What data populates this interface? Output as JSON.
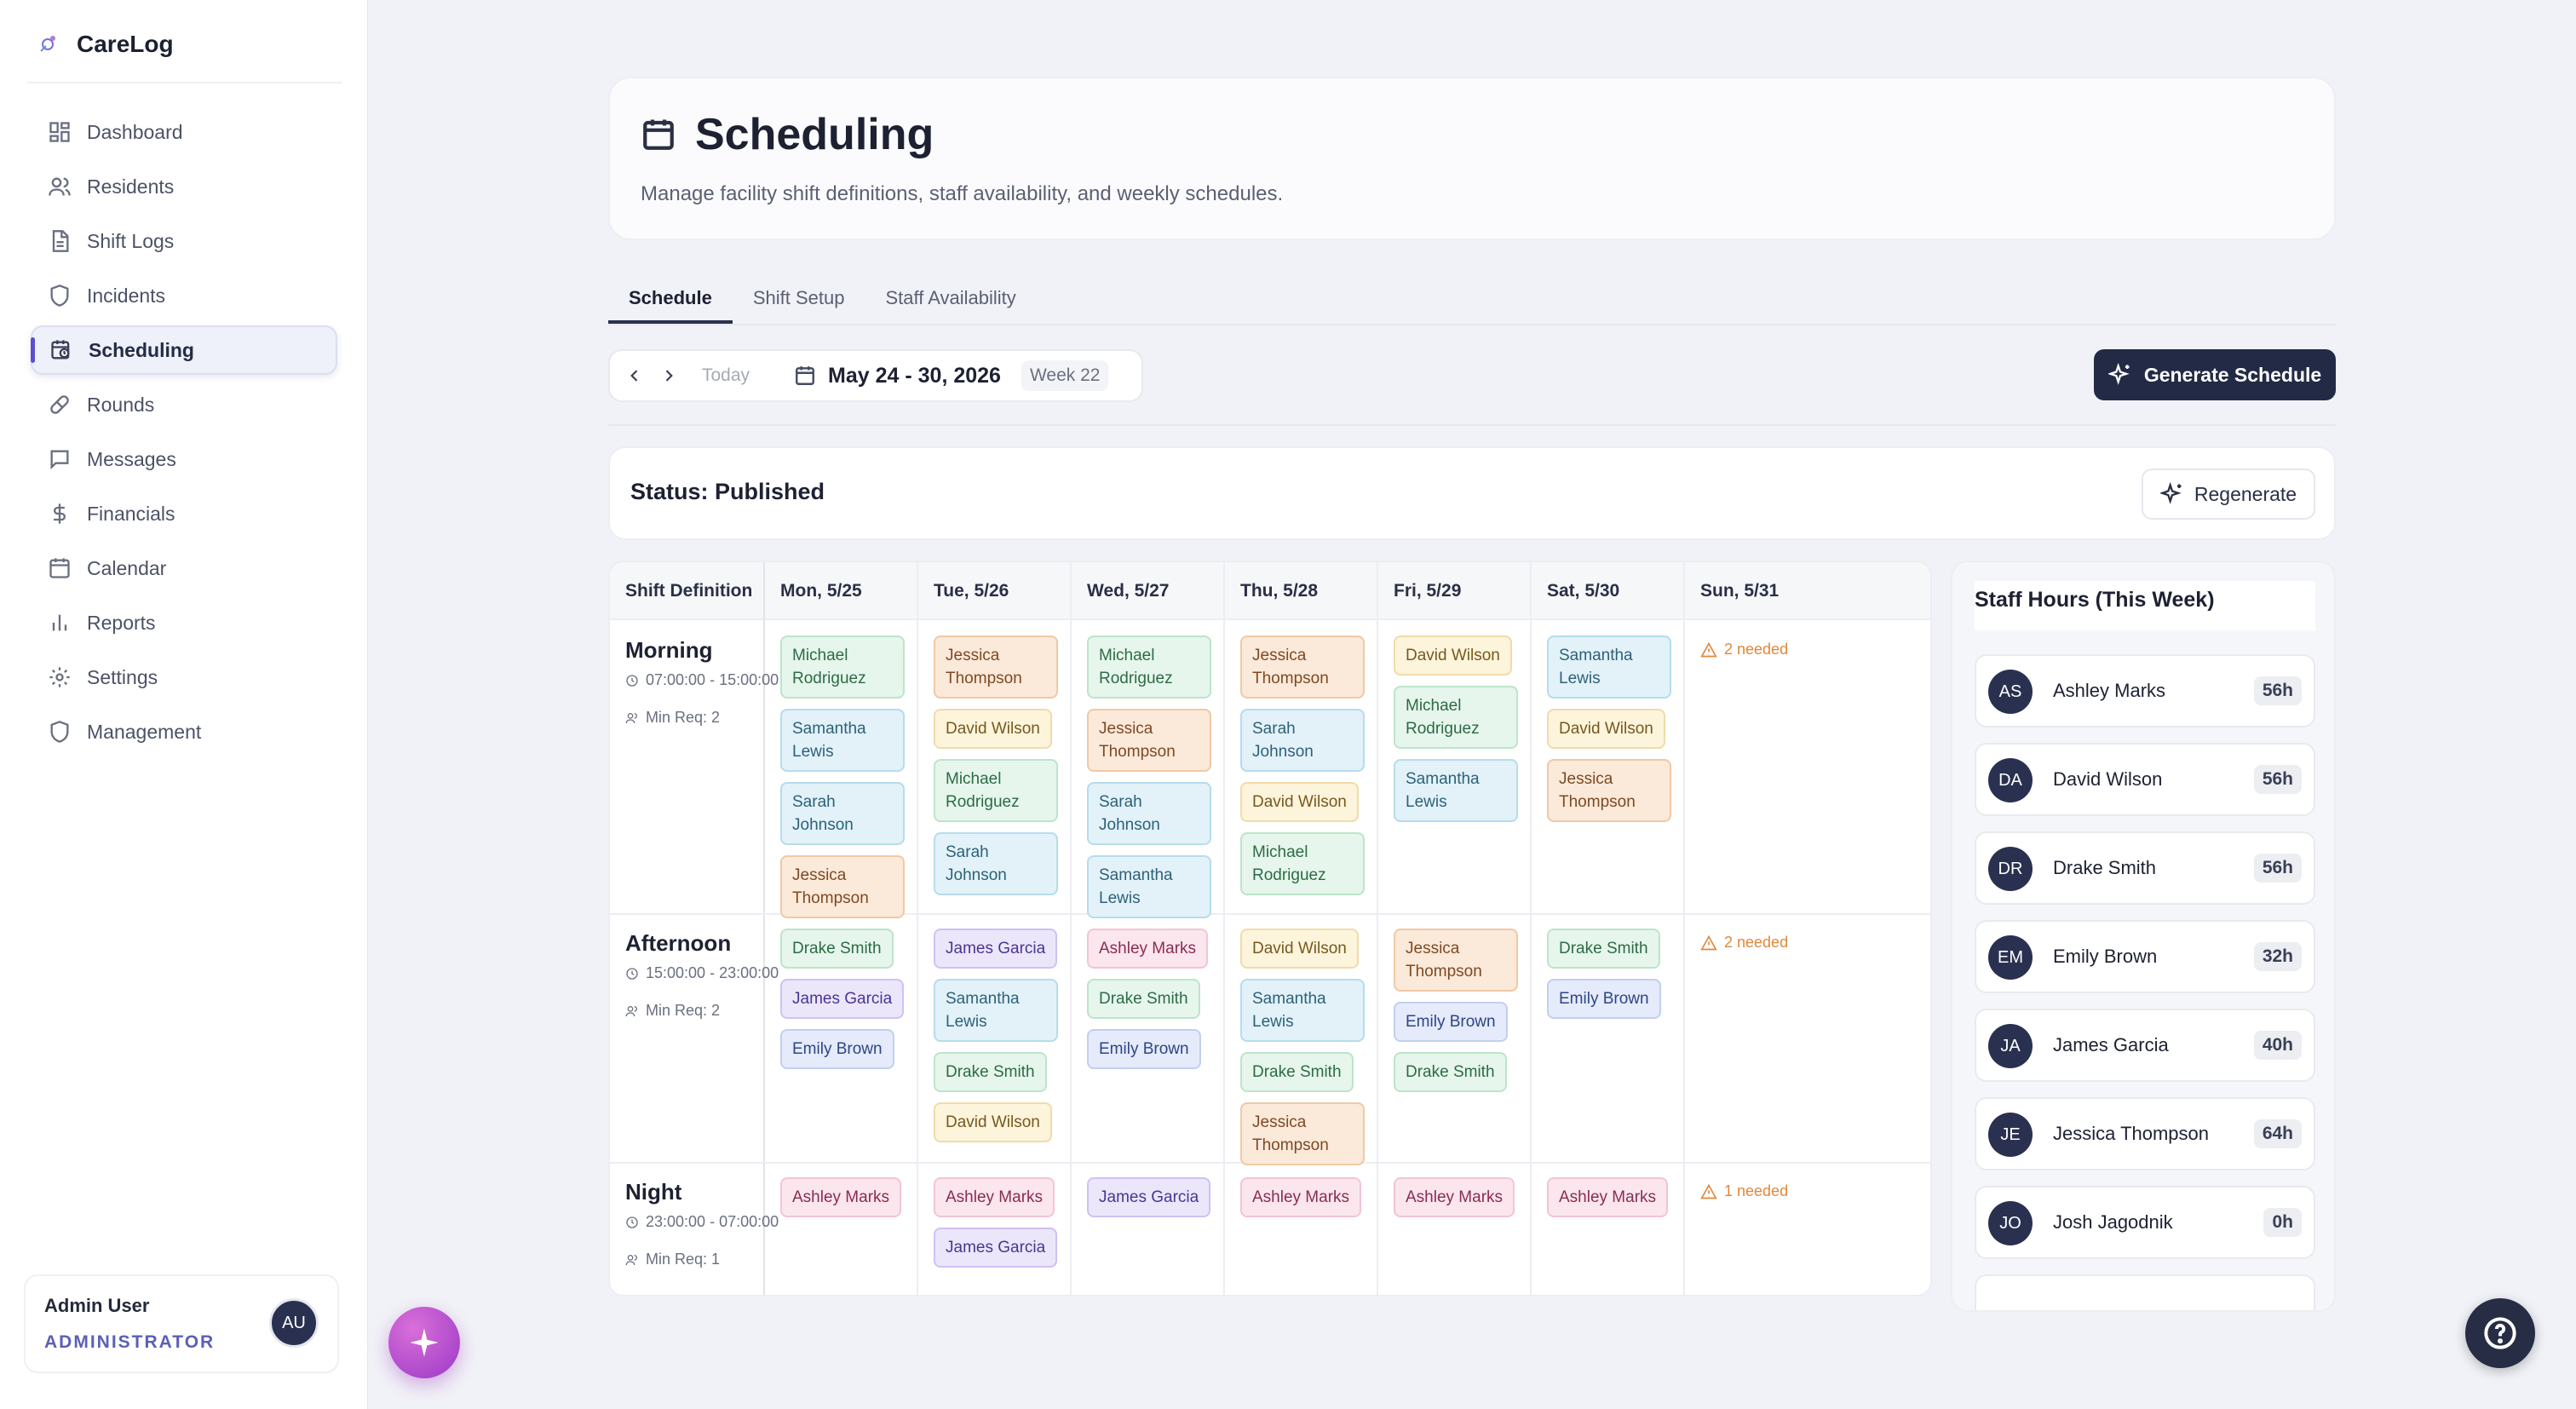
{
  "app": {
    "name": "CareLog"
  },
  "sidebar": {
    "items": [
      {
        "label": "Dashboard",
        "icon": "dashboard-icon"
      },
      {
        "label": "Residents",
        "icon": "users-icon"
      },
      {
        "label": "Shift Logs",
        "icon": "file-icon"
      },
      {
        "label": "Incidents",
        "icon": "shield-icon"
      },
      {
        "label": "Scheduling",
        "icon": "calendar-clock-icon",
        "active": true
      },
      {
        "label": "Rounds",
        "icon": "pill-icon"
      },
      {
        "label": "Messages",
        "icon": "message-icon"
      },
      {
        "label": "Financials",
        "icon": "dollar-icon"
      },
      {
        "label": "Calendar",
        "icon": "calendar-icon"
      },
      {
        "label": "Reports",
        "icon": "chart-icon"
      },
      {
        "label": "Settings",
        "icon": "gear-icon"
      },
      {
        "label": "Management",
        "icon": "shield-icon"
      }
    ],
    "user": {
      "name": "Admin User",
      "role": "ADMINISTRATOR",
      "initials": "AU"
    }
  },
  "header": {
    "title": "Scheduling",
    "subtitle": "Manage facility shift definitions, staff availability, and weekly schedules."
  },
  "tabs": [
    "Schedule",
    "Shift Setup",
    "Staff Availability"
  ],
  "toolbar": {
    "today": "Today",
    "date_range": "May 24 - 30, 2026",
    "week": "Week 22",
    "generate": "Generate Schedule"
  },
  "status": {
    "text": "Status: Published",
    "regenerate": "Regenerate"
  },
  "grid": {
    "header_first": "Shift Definition",
    "days": [
      "Mon, 5/25",
      "Tue, 5/26",
      "Wed, 5/27",
      "Thu, 5/28",
      "Fri, 5/29",
      "Sat, 5/30",
      "Sun, 5/31"
    ],
    "shifts": [
      {
        "name": "Morning",
        "time": "07:00:00 - 15:00:00",
        "min": "Min Req: 2",
        "cells": [
          [
            [
              "Michael Rodriguez",
              "green"
            ],
            [
              "Samantha Lewis",
              "blue"
            ],
            [
              "Sarah Johnson",
              "blue"
            ],
            [
              "Jessica Thompson",
              "orange"
            ]
          ],
          [
            [
              "Jessica Thompson",
              "orange"
            ],
            [
              "David Wilson",
              "yellow"
            ],
            [
              "Michael Rodriguez",
              "green"
            ],
            [
              "Sarah Johnson",
              "blue"
            ]
          ],
          [
            [
              "Michael Rodriguez",
              "green"
            ],
            [
              "Jessica Thompson",
              "orange"
            ],
            [
              "Sarah Johnson",
              "blue"
            ],
            [
              "Samantha Lewis",
              "blue"
            ]
          ],
          [
            [
              "Jessica Thompson",
              "orange"
            ],
            [
              "Sarah Johnson",
              "blue"
            ],
            [
              "David Wilson",
              "yellow"
            ],
            [
              "Michael Rodriguez",
              "green"
            ]
          ],
          [
            [
              "David Wilson",
              "yellow"
            ],
            [
              "Michael Rodriguez",
              "green"
            ],
            [
              "Samantha Lewis",
              "blue"
            ]
          ],
          [
            [
              "Samantha Lewis",
              "blue"
            ],
            [
              "David Wilson",
              "yellow"
            ],
            [
              "Jessica Thompson",
              "orange"
            ]
          ],
          []
        ],
        "needed": "2 needed"
      },
      {
        "name": "Afternoon",
        "time": "15:00:00 - 23:00:00",
        "min": "Min Req: 2",
        "cells": [
          [
            [
              "Drake Smith",
              "green"
            ],
            [
              "James Garcia",
              "purple"
            ],
            [
              "Emily Brown",
              "indigo"
            ]
          ],
          [
            [
              "James Garcia",
              "purple"
            ],
            [
              "Samantha Lewis",
              "blue"
            ],
            [
              "Drake Smith",
              "green"
            ],
            [
              "David Wilson",
              "yellow"
            ]
          ],
          [
            [
              "Ashley Marks",
              "pink"
            ],
            [
              "Drake Smith",
              "green"
            ],
            [
              "Emily Brown",
              "indigo"
            ]
          ],
          [
            [
              "David Wilson",
              "yellow"
            ],
            [
              "Samantha Lewis",
              "blue"
            ],
            [
              "Drake Smith",
              "green"
            ],
            [
              "Jessica Thompson",
              "orange"
            ]
          ],
          [
            [
              "Jessica Thompson",
              "orange"
            ],
            [
              "Emily Brown",
              "indigo"
            ],
            [
              "Drake Smith",
              "green"
            ]
          ],
          [
            [
              "Drake Smith",
              "green"
            ],
            [
              "Emily Brown",
              "indigo"
            ]
          ],
          []
        ],
        "needed": "2 needed"
      },
      {
        "name": "Night",
        "time": "23:00:00 - 07:00:00",
        "min": "Min Req: 1",
        "cells": [
          [
            [
              "Ashley Marks",
              "pink"
            ]
          ],
          [
            [
              "Ashley Marks",
              "pink"
            ],
            [
              "James Garcia",
              "purple"
            ]
          ],
          [
            [
              "James Garcia",
              "purple"
            ]
          ],
          [
            [
              "Ashley Marks",
              "pink"
            ]
          ],
          [
            [
              "Ashley Marks",
              "pink"
            ]
          ],
          [
            [
              "Ashley Marks",
              "pink"
            ]
          ],
          []
        ],
        "needed": "1 needed"
      }
    ]
  },
  "staff_hours": {
    "title": "Staff Hours (This Week)",
    "rows": [
      {
        "initials": "AS",
        "name": "Ashley Marks",
        "hours": "56h"
      },
      {
        "initials": "DA",
        "name": "David Wilson",
        "hours": "56h"
      },
      {
        "initials": "DR",
        "name": "Drake Smith",
        "hours": "56h"
      },
      {
        "initials": "EM",
        "name": "Emily Brown",
        "hours": "32h"
      },
      {
        "initials": "JA",
        "name": "James Garcia",
        "hours": "40h"
      },
      {
        "initials": "JE",
        "name": "Jessica Thompson",
        "hours": "64h"
      },
      {
        "initials": "JO",
        "name": "Josh Jagodnik",
        "hours": "0h"
      }
    ]
  },
  "colors": {
    "accent": "#222a45",
    "brand_purple": "#5a4fcf",
    "warning": "#e0883a"
  }
}
